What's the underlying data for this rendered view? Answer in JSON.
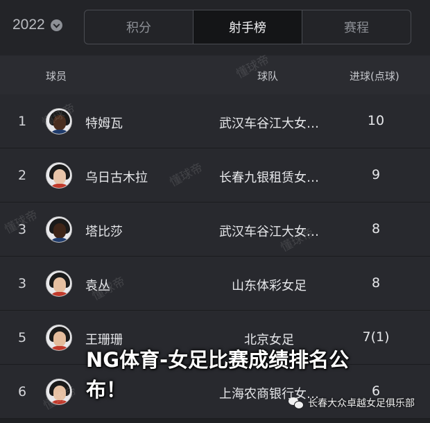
{
  "season": {
    "year": "2022"
  },
  "tabs": [
    {
      "label": "积分",
      "active": false
    },
    {
      "label": "射手榜",
      "active": true
    },
    {
      "label": "赛程",
      "active": false
    }
  ],
  "table": {
    "headers": {
      "player": "球员",
      "team": "球队",
      "goals": "进球(点球)"
    },
    "rows": [
      {
        "rank": "1",
        "name": "特姆瓦",
        "team": "武汉车谷江大女…",
        "goals": "10"
      },
      {
        "rank": "2",
        "name": "乌日古木拉",
        "team": "长春九银租赁女…",
        "goals": "9"
      },
      {
        "rank": "3",
        "name": "塔比莎",
        "team": "武汉车谷江大女…",
        "goals": "8"
      },
      {
        "rank": "3",
        "name": "袁丛",
        "team": "山东体彩女足",
        "goals": "8"
      },
      {
        "rank": "5",
        "name": "王珊珊",
        "team": "北京女足",
        "goals": "7(1)"
      },
      {
        "rank": "6",
        "name": "",
        "team": "上海农商银行女…",
        "goals": "6"
      }
    ]
  },
  "watermark": "懂球帝",
  "overlay": {
    "headline": "NG体育-女足比赛成绩排名公布！",
    "source": "长春大众卓越女足俱乐部"
  },
  "colors": {
    "background": "#1f2023",
    "active_tab": "#141517",
    "row": "#28292e",
    "header": "#2b2c31"
  }
}
